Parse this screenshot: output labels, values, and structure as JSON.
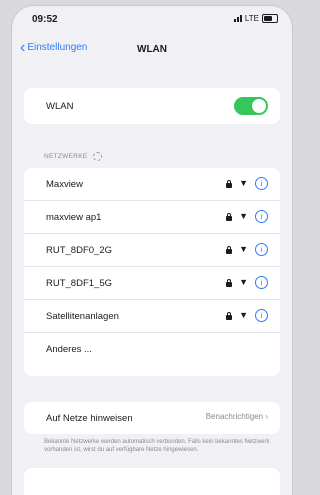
{
  "status_bar": {
    "time": "09:52",
    "network": "LTE"
  },
  "nav": {
    "back_label": "Einstellungen",
    "title": "WLAN"
  },
  "wlan_toggle": {
    "label": "WLAN",
    "on": true
  },
  "networks": {
    "header": "NETZWERKE",
    "items": [
      {
        "name": "Maxview"
      },
      {
        "name": "maxview ap1"
      },
      {
        "name": "RUT_8DF0_2G"
      },
      {
        "name": "RUT_8DF1_5G"
      },
      {
        "name": "Satellitenanlagen"
      }
    ],
    "other_label": "Anderes ..."
  },
  "notify": {
    "label": "Auf Netze hinweisen",
    "value": "Benachrichtigen",
    "footnote": "Bekannte Netzwerke werden automatisch verbunden. Falls kein bekanntes Netzwerk vorhanden ist, wirst du auf verfügbare Netze hingewiesen."
  },
  "colors": {
    "accent": "#2f7cf6",
    "toggle_on": "#35c759",
    "background": "#f1f1f5"
  }
}
